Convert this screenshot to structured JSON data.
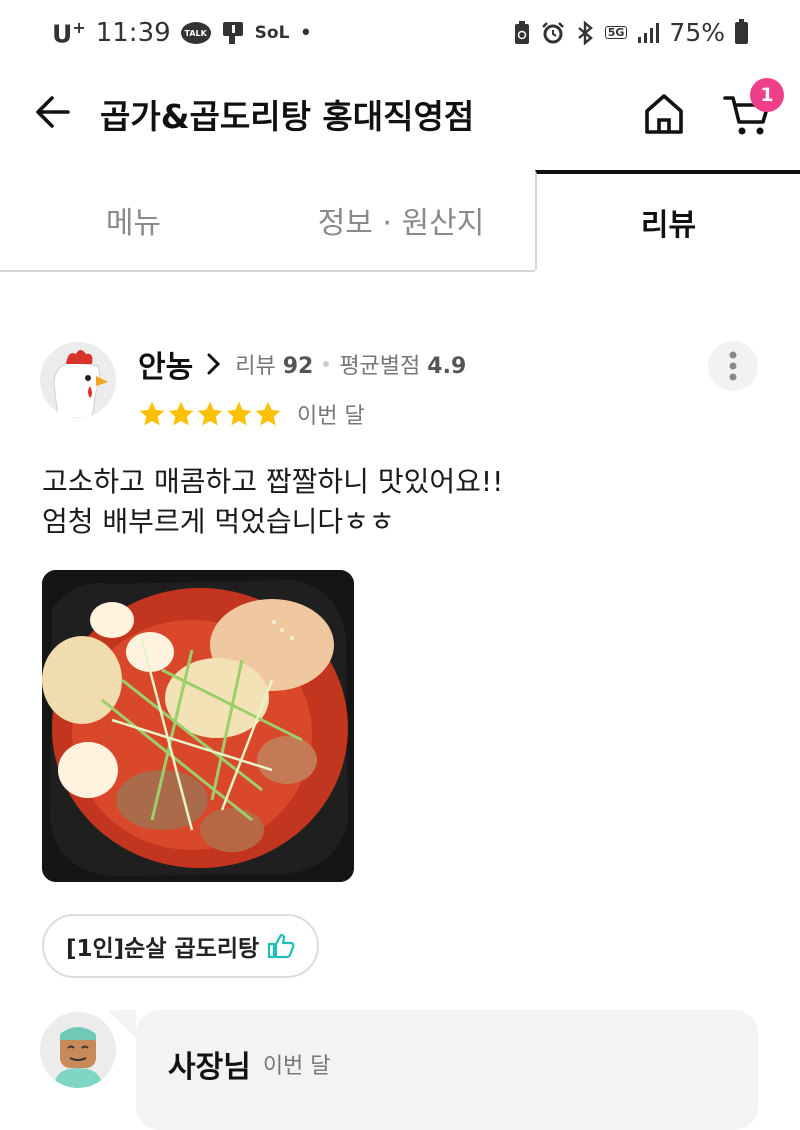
{
  "status_bar": {
    "carrier": "U",
    "carrier_sup": "+",
    "time": "11:39",
    "talk_label": "TALK",
    "sol_label": "SoL",
    "network": "5G",
    "battery": "75%",
    "icons": [
      "kakaotalk-icon",
      "notification-icon",
      "sol-icon",
      "battery-saver-icon",
      "alarm-icon",
      "bluetooth-icon",
      "signal-icon",
      "battery-icon"
    ]
  },
  "header": {
    "title": "곱가&곱도리탕 홍대직영점",
    "cart_count": "1"
  },
  "tabs": [
    {
      "label": "메뉴",
      "active": false
    },
    {
      "label": "정보 · 원산지",
      "active": false
    },
    {
      "label": "리뷰",
      "active": true
    }
  ],
  "review": {
    "author": "안농",
    "review_count_label": "리뷰",
    "review_count": "92",
    "avg_rating_label": "평균별점",
    "avg_rating": "4.9",
    "stars": 5,
    "date": "이번 달",
    "text_lines": [
      "고소하고 매콤하고 짭짤하니 맛있어요!!",
      "엄청 배부르게 먹었습니다ㅎㅎ"
    ],
    "menu_tag": "[1인]순살 곱도리탕"
  },
  "owner_reply": {
    "name": "사장님",
    "date": "이번 달"
  },
  "colors": {
    "badge": "#ef3e8a",
    "star": "#ffc107",
    "thumb": "#1fbfb8",
    "reply_bg": "#f2f3f5"
  }
}
